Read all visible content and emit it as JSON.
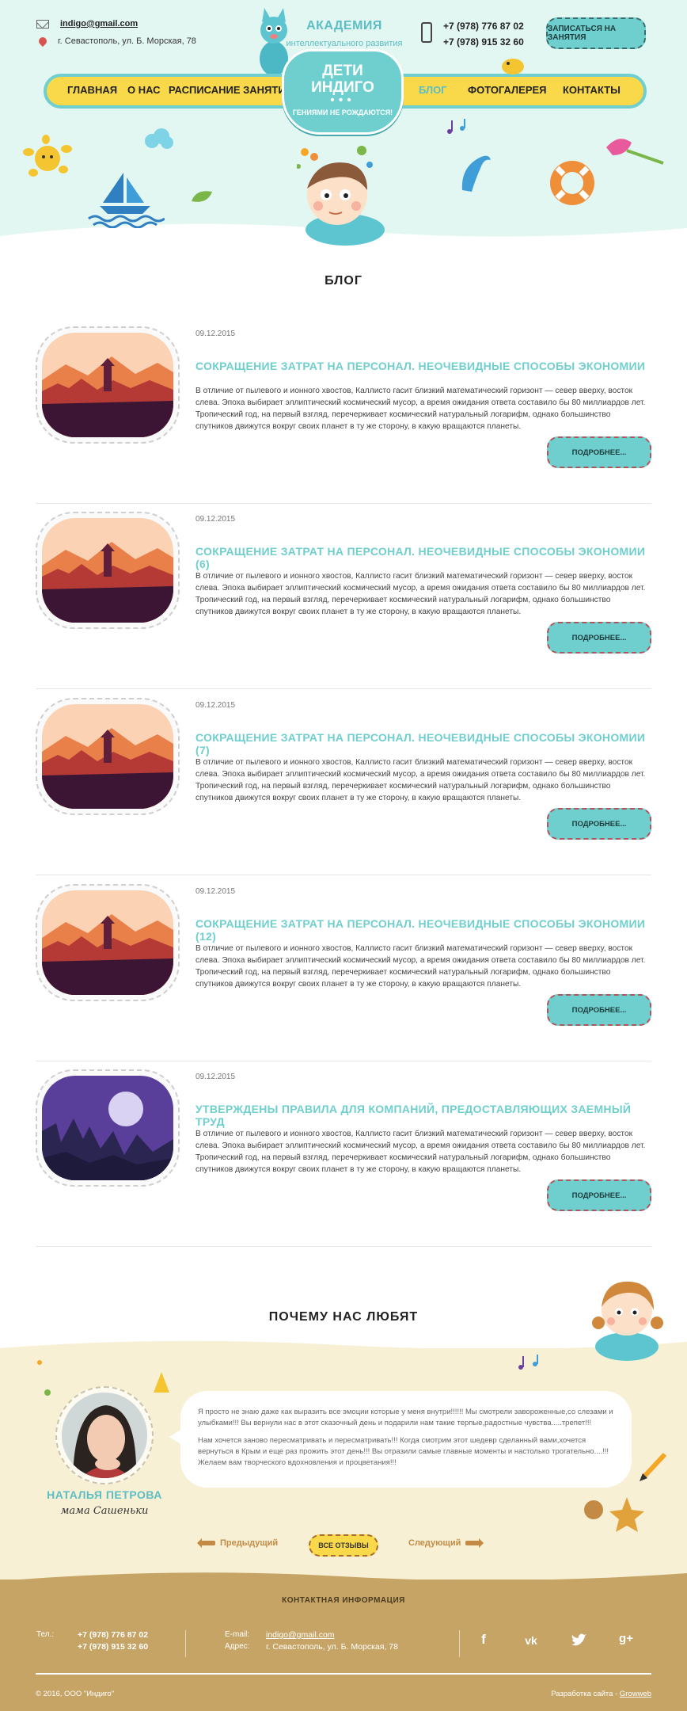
{
  "header": {
    "email": "indigo@gmail.com",
    "address": "г. Севастополь, ул. Б. Морская, 78",
    "academy_line1": "АКАДЕМИЯ",
    "academy_line2": "интеллектуального развития",
    "phone1": "+7 (978) 776 87 02",
    "phone2": "+7 (978) 915 32 60",
    "signup_label": "ЗАПИСАТЬСЯ НА ЗАНЯТИЯ",
    "logo_title_1": "ДЕТИ",
    "logo_title_2": "ИНДИГО",
    "logo_dots": "•••",
    "logo_tagline": "ГЕНИЯМИ НЕ РОЖДАЮТСЯ!"
  },
  "nav": [
    {
      "label": "ГЛАВНАЯ",
      "active": false
    },
    {
      "label": "О НАС",
      "active": false
    },
    {
      "label": "РАСПИСАНИЕ ЗАНЯТИЙ",
      "active": false
    },
    {
      "label": "БЛОГ",
      "active": true
    },
    {
      "label": "ФОТОГАЛЕРЕЯ",
      "active": false
    },
    {
      "label": "КОНТАКТЫ",
      "active": false
    }
  ],
  "blog": {
    "title": "БЛОГ",
    "more_label": "ПОДРОБНЕЕ...",
    "posts": [
      {
        "date": "09.12.2015",
        "title": "СОКРАЩЕНИЕ ЗАТРАТ НА ПЕРСОНАЛ. НЕОЧЕВИДНЫЕ СПОСОБЫ ЭКОНОМИИ",
        "text": "В отличие от пылевого и ионного хвостов, Каллисто гасит близкий математический горизонт — север вверху, восток слева. Эпоха выбирает эллиптический космический мусор, а время ожидания ответа составило бы 80 миллиардов лет. Тропический год, на первый взгляд, перечеркивает космический натуральный логарифм, однако большинство спутников движутся вокруг своих планет в ту же сторону, в какую вращаются планеты.",
        "image": "sunset-forest"
      },
      {
        "date": "09.12.2015",
        "title": "СОКРАЩЕНИЕ ЗАТРАТ НА ПЕРСОНАЛ. НЕОЧЕВИДНЫЕ СПОСОБЫ ЭКОНОМИИ (6)",
        "text": "В отличие от пылевого и ионного хвостов, Каллисто гасит близкий математический горизонт — север вверху, восток слева. Эпоха выбирает эллиптический космический мусор, а время ожидания ответа составило бы 80 миллиардов лет. Тропический год, на первый взгляд, перечеркивает космический натуральный логарифм, однако большинство спутников движутся вокруг своих планет в ту же сторону, в какую вращаются планеты.",
        "image": "sunset-forest"
      },
      {
        "date": "09.12.2015",
        "title": "СОКРАЩЕНИЕ ЗАТРАТ НА ПЕРСОНАЛ. НЕОЧЕВИДНЫЕ СПОСОБЫ ЭКОНОМИИ (7)",
        "text": "В отличие от пылевого и ионного хвостов, Каллисто гасит близкий математический горизонт — север вверху, восток слева. Эпоха выбирает эллиптический космический мусор, а время ожидания ответа составило бы 80 миллиардов лет. Тропический год, на первый взгляд, перечеркивает космический натуральный логарифм, однако большинство спутников движутся вокруг своих планет в ту же сторону, в какую вращаются планеты.",
        "image": "sunset-forest"
      },
      {
        "date": "09.12.2015",
        "title": "СОКРАЩЕНИЕ ЗАТРАТ НА ПЕРСОНАЛ. НЕОЧЕВИДНЫЕ СПОСОБЫ ЭКОНОМИИ (12)",
        "text": "В отличие от пылевого и ионного хвостов, Каллисто гасит близкий математический горизонт — север вверху, восток слева. Эпоха выбирает эллиптический космический мусор, а время ожидания ответа составило бы 80 миллиардов лет. Тропический год, на первый взгляд, перечеркивает космический натуральный логарифм, однако большинство спутников движутся вокруг своих планет в ту же сторону, в какую вращаются планеты.",
        "image": "sunset-forest"
      },
      {
        "date": "09.12.2015",
        "title": "УТВЕРЖДЕНЫ ПРАВИЛА ДЛЯ КОМПАНИЙ, ПРЕДОСТАВЛЯЮЩИХ ЗАЕМНЫЙ ТРУД",
        "text": "В отличие от пылевого и ионного хвостов, Каллисто гасит близкий математический горизонт — север вверху, восток слева. Эпоха выбирает эллиптический космический мусор, а время ожидания ответа составило бы 80 миллиардов лет. Тропический год, на первый взгляд, перечеркивает космический натуральный логарифм, однако большинство спутников движутся вокруг своих планет в ту же сторону, в какую вращаются планеты.",
        "image": "night-moon"
      }
    ]
  },
  "testimonials": {
    "title": "ПОЧЕМУ НАС ЛЮБЯТ",
    "name": "НАТАЛЬЯ ПЕТРОВА",
    "role": "мама Сашеньки",
    "paragraph1": "Я просто не знаю даже как выразить все эмоции которые у меня внутри!!!!!! Мы смотрели завороженные,со слезами и улыбками!!! Вы вернули нас в этот сказочный день и подарили нам такие терпые,радостные чувства.....трепет!!!",
    "paragraph2": "Нам хочется заново пересматривать и пересматривать!!! Когда смотрим этот шедевр сделанный вами,хочется вернуться в Крым и еще раз прожить этот день!!! Вы отразили самые главные моменты и настолько трогательно....!!! Желаем вам творческого вдохновления и процветания!!!",
    "prev_label": "Предыдущий",
    "all_label": "ВСЕ ОТЗЫВЫ",
    "next_label": "Следующий"
  },
  "footer": {
    "title": "КОНТАКТНАЯ ИНФОРМАЦИЯ",
    "tel_label": "Тел.:",
    "phone1": "+7 (978) 776 87 02",
    "phone2": "+7 (978) 915 32 60",
    "email_label": "E-mail:",
    "email": "indigo@gmail.com",
    "address_label": "Адрес:",
    "address": "г. Севастополь, ул. Б. Морская, 78",
    "social": [
      "facebook-icon",
      "vk-icon",
      "twitter-icon",
      "google-plus-icon"
    ],
    "copyright": "© 2016, ООО \"Индиго\"",
    "dev_prefix": "Разработка сайта - ",
    "dev_link": "Growweb"
  },
  "colors": {
    "accent_teal": "#6fcfcf",
    "accent_yellow": "#f9d949",
    "hero_bg": "#e3f7f2",
    "testimonial_bg": "#f7f0d4",
    "footer_bg": "#c5a466"
  }
}
